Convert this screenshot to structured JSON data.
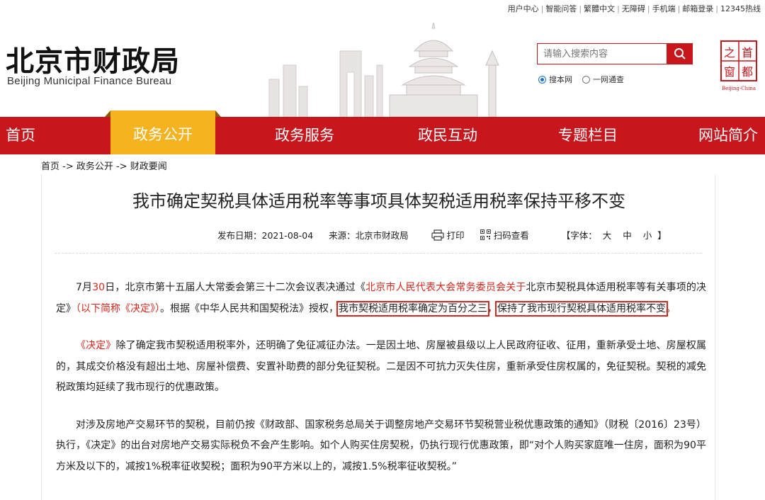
{
  "toplinks": [
    "用户中心",
    "智能问答",
    "繁體中文",
    "无障碍",
    "手机端",
    "邮箱登录",
    "12345热线"
  ],
  "logo": {
    "cn": "北京市财政局",
    "en": "Beijing Municipal Finance Bureau"
  },
  "search": {
    "placeholder": "请输入搜索内容",
    "radio_site": "搜本网",
    "radio_all": "一网通查",
    "selected": "搜本网"
  },
  "seal": {
    "chars": [
      "首",
      "之",
      "都",
      "窗"
    ],
    "caption": "Beijing-China"
  },
  "nav": {
    "items": [
      "首页",
      "政务公开",
      "政务服务",
      "政民互动",
      "专题栏目",
      "网站简介"
    ],
    "active": "政务公开"
  },
  "breadcrumb": "首页 -> 政务公开 -> 财政要闻",
  "article": {
    "title": "我市确定契税具体适用税率等事项具体契税适用税率保持平移不变",
    "date": "发布日期：2021-08-04",
    "source": "来源：北京市财政局",
    "print_label": "打印",
    "scan_label": "扫码查看",
    "font_label": "【字体：",
    "font_sizes": [
      "大",
      "中",
      "小"
    ],
    "font_close": "】",
    "p1": {
      "a": "7月",
      "b": "30",
      "c": "日，北京市第十五届人大常委会第三十二次会议表决通过《",
      "d": "北京市人民代表大会常务委员会关于",
      "e": "北京市契税具体适用税率等有关事项的决定》",
      "f": "（以下简称《决定》）",
      "g": "。根据《中华人民共和国契税法》授权，",
      "h": "我市契税适用税率确定为百分之三",
      "i": "，",
      "j": "保持了我市现行契税具体适用税率不变",
      "k": "。"
    },
    "p2": {
      "a": "《决定》",
      "b": "除了确定我市契税适用税率外，还明确了免征减征办法。一是因土地、房屋被县级以上人民政府征收、征用，重新承受土地、房屋权属的，其成交价格没有超出土地、房屋补偿费、安置补助费的部分免征契税。二是因不可抗力灭失住房，重新承受住房权属的，免征契税。契税的减免税政策均延续了我市现行的优惠政策。"
    },
    "p3": "对涉及房地产交易环节的契税，目前仍按《财政部、国家税务总局关于调整房地产交易环节契税营业税优惠政策的通知》（财税〔2016〕23号）执行，《决定》的出台对房地产交易实际税负不会产生影响。如个人购买住房契税，仍执行现行优惠政策，即“对个人购买家庭唯一住房，面积为90平方米及以下的，减按1%税率征收契税；面积为90平方米以上的，减按1.5%税率征收契税。”"
  },
  "colors": {
    "brand_red": "#c8161d",
    "nav_active": "#f5b41f",
    "text_red": "#d8261c",
    "radio_blue": "#1a73c8"
  },
  "icons": [
    "search-icon",
    "print-icon",
    "qrcode-icon"
  ]
}
